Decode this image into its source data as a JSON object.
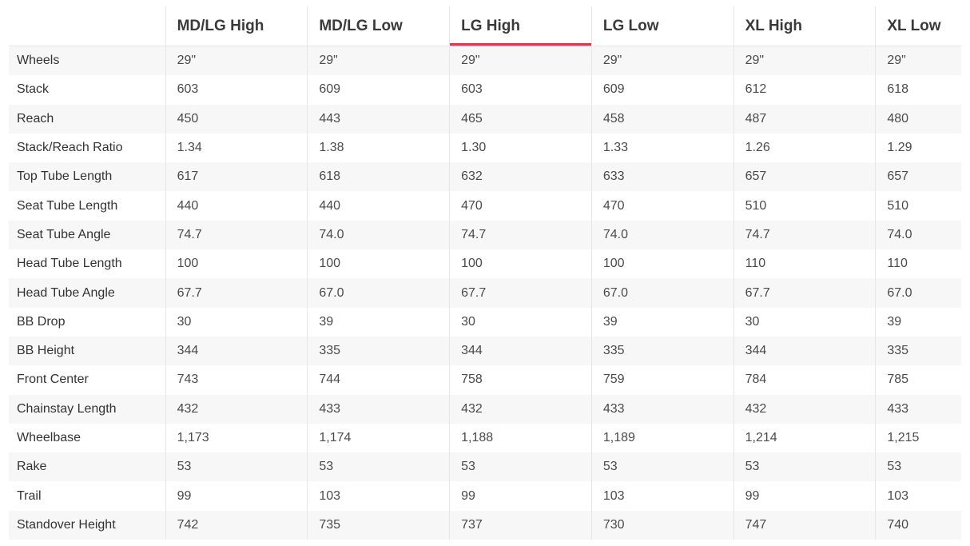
{
  "table": {
    "columns": [
      "MD/LG High",
      "MD/LG Low",
      "LG High",
      "LG Low",
      "XL High",
      "XL Low"
    ],
    "active_column": "LG High",
    "accent_color": "#e5344f",
    "rows": [
      {
        "label": "Wheels",
        "values": [
          "29\"",
          "29\"",
          "29\"",
          "29\"",
          "29\"",
          "29\""
        ]
      },
      {
        "label": "Stack",
        "values": [
          "603",
          "609",
          "603",
          "609",
          "612",
          "618"
        ]
      },
      {
        "label": "Reach",
        "values": [
          "450",
          "443",
          "465",
          "458",
          "487",
          "480"
        ]
      },
      {
        "label": "Stack/Reach Ratio",
        "values": [
          "1.34",
          "1.38",
          "1.30",
          "1.33",
          "1.26",
          "1.29"
        ]
      },
      {
        "label": "Top Tube Length",
        "values": [
          "617",
          "618",
          "632",
          "633",
          "657",
          "657"
        ]
      },
      {
        "label": "Seat Tube Length",
        "values": [
          "440",
          "440",
          "470",
          "470",
          "510",
          "510"
        ]
      },
      {
        "label": "Seat Tube Angle",
        "values": [
          "74.7",
          "74.0",
          "74.7",
          "74.0",
          "74.7",
          "74.0"
        ]
      },
      {
        "label": "Head Tube Length",
        "values": [
          "100",
          "100",
          "100",
          "100",
          "110",
          "110"
        ]
      },
      {
        "label": "Head Tube Angle",
        "values": [
          "67.7",
          "67.0",
          "67.7",
          "67.0",
          "67.7",
          "67.0"
        ]
      },
      {
        "label": "BB Drop",
        "values": [
          "30",
          "39",
          "30",
          "39",
          "30",
          "39"
        ]
      },
      {
        "label": "BB Height",
        "values": [
          "344",
          "335",
          "344",
          "335",
          "344",
          "335"
        ]
      },
      {
        "label": "Front Center",
        "values": [
          "743",
          "744",
          "758",
          "759",
          "784",
          "785"
        ]
      },
      {
        "label": "Chainstay Length",
        "values": [
          "432",
          "433",
          "432",
          "433",
          "432",
          "433"
        ]
      },
      {
        "label": "Wheelbase",
        "values": [
          "1,173",
          "1,174",
          "1,188",
          "1,189",
          "1,214",
          "1,215"
        ]
      },
      {
        "label": "Rake",
        "values": [
          "53",
          "53",
          "53",
          "53",
          "53",
          "53"
        ]
      },
      {
        "label": "Trail",
        "values": [
          "99",
          "103",
          "99",
          "103",
          "99",
          "103"
        ]
      },
      {
        "label": "Standover Height",
        "values": [
          "742",
          "735",
          "737",
          "730",
          "747",
          "740"
        ]
      }
    ]
  }
}
